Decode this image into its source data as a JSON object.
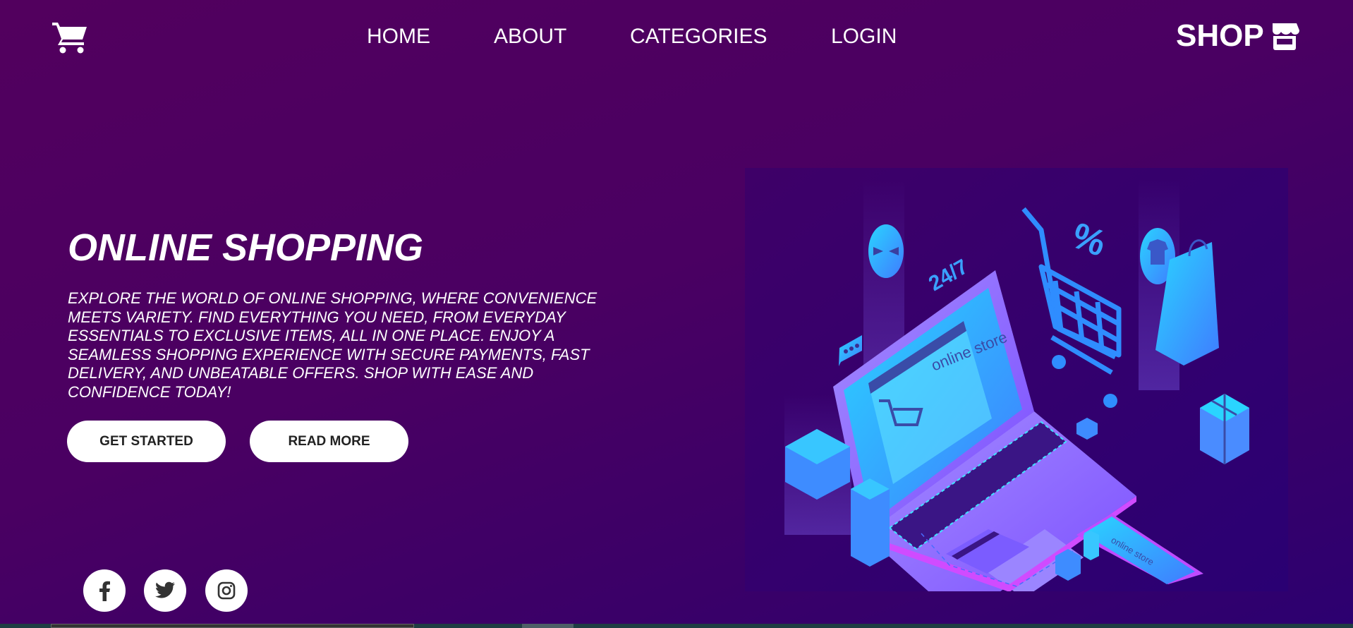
{
  "header": {
    "logo_icon": "shopping-cart-icon",
    "nav": [
      {
        "label": "HOME"
      },
      {
        "label": "ABOUT"
      },
      {
        "label": "CATEGORIES"
      },
      {
        "label": "LOGIN"
      }
    ],
    "shop_label": "SHOP",
    "shop_icon": "store-icon"
  },
  "hero": {
    "title": "ONLINE SHOPPING",
    "description": "EXPLORE THE WORLD OF ONLINE SHOPPING, WHERE CONVENIENCE MEETS VARIETY. FIND EVERYTHING YOU NEED, FROM EVERYDAY ESSENTIALS TO EXCLUSIVE ITEMS, ALL IN ONE PLACE. ENJOY A SEAMLESS SHOPPING EXPERIENCE WITH SECURE PAYMENTS, FAST DELIVERY, AND UNBEATABLE OFFERS. SHOP WITH EASE AND CONFIDENCE TODAY!",
    "buttons": [
      {
        "label": "GET STARTED"
      },
      {
        "label": "READ MORE"
      }
    ]
  },
  "illustration": {
    "screen_text": "online store",
    "badge_text": "24/7",
    "discount_text": "%"
  },
  "social": [
    {
      "icon": "facebook-icon"
    },
    {
      "icon": "twitter-icon"
    },
    {
      "icon": "instagram-icon"
    }
  ],
  "colors": {
    "background_start": "#52005e",
    "background_end": "#2c0070",
    "button_bg": "#ffffff",
    "illustration_accent": "#29b6f6"
  }
}
